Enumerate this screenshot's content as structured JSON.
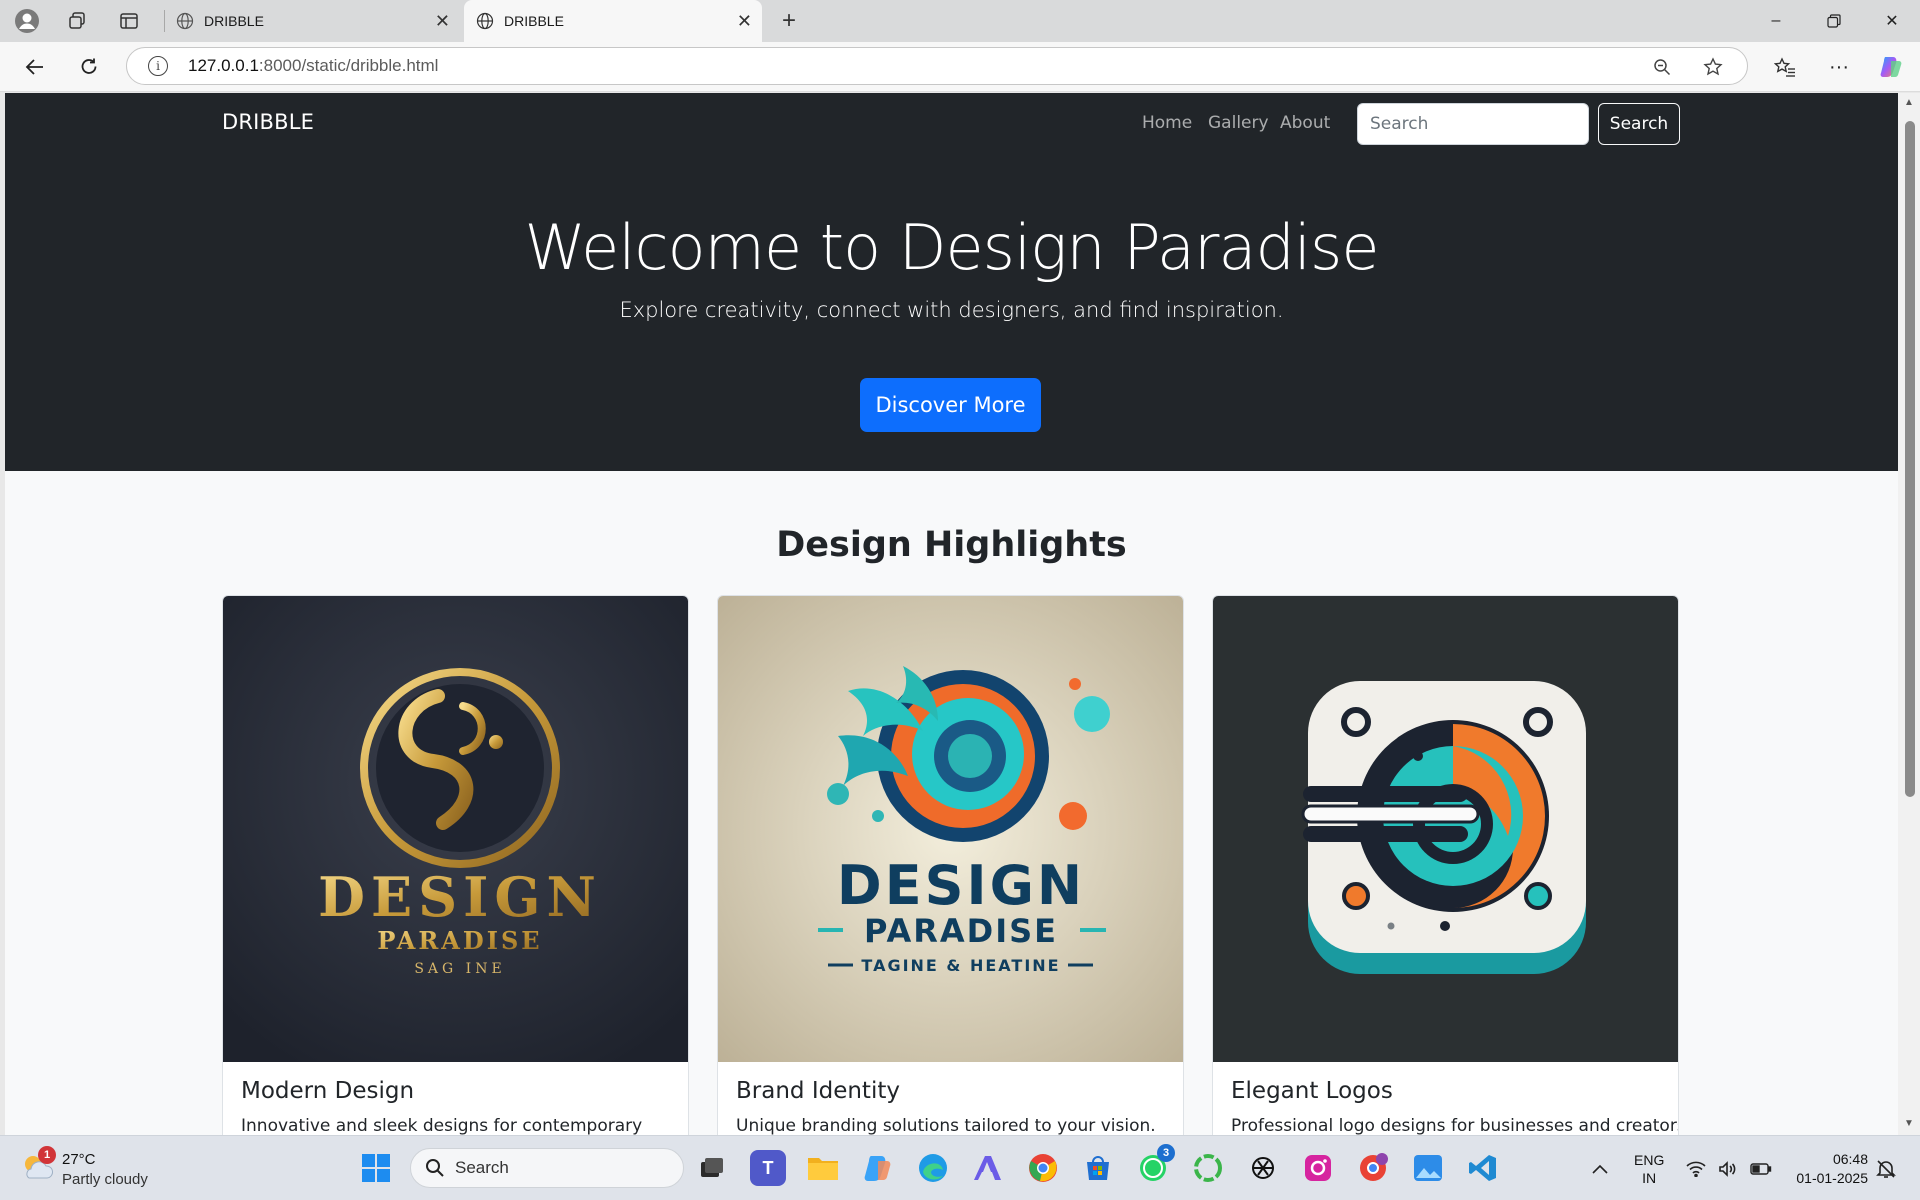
{
  "browser": {
    "tabs": [
      {
        "title": "DRIBBLE",
        "active": false
      },
      {
        "title": "DRIBBLE",
        "active": true
      }
    ],
    "url": {
      "host": "127.0.0.1",
      "path": ":8000/static/dribble.html"
    }
  },
  "page": {
    "navbar": {
      "brand": "DRIBBLE",
      "links": [
        "Home",
        "Gallery",
        "About"
      ],
      "search_placeholder": "Search",
      "search_button": "Search"
    },
    "hero": {
      "title": "Welcome to Design Paradise",
      "subtitle": "Explore creativity, connect with designers, and find inspiration.",
      "button": "Discover More"
    },
    "section_title": "Design Highlights",
    "cards": [
      {
        "title": "Modern Design",
        "text": "Innovative and sleek designs for contemporary",
        "logo_lines": [
          "DESIGN",
          "PARADISE",
          "SAG INE"
        ]
      },
      {
        "title": "Brand Identity",
        "text": "Unique branding solutions tailored to your vision.",
        "logo_lines": [
          "DESIGN",
          "PARADISE",
          "TAGINE & HEATINE"
        ]
      },
      {
        "title": "Elegant Logos",
        "text": "Professional logo designs for businesses and creators.",
        "logo_lines": []
      }
    ]
  },
  "taskbar": {
    "weather": {
      "temp": "27°C",
      "desc": "Partly cloudy",
      "badge": "1"
    },
    "search_label": "Search",
    "whatsapp_badge": "3",
    "lang": {
      "line1": "ENG",
      "line2": "IN"
    },
    "time": "06:48",
    "date": "01-01-2025"
  },
  "colors": {
    "dark": "#212529",
    "primary": "#0d6efd",
    "light": "#f8f9fa"
  }
}
